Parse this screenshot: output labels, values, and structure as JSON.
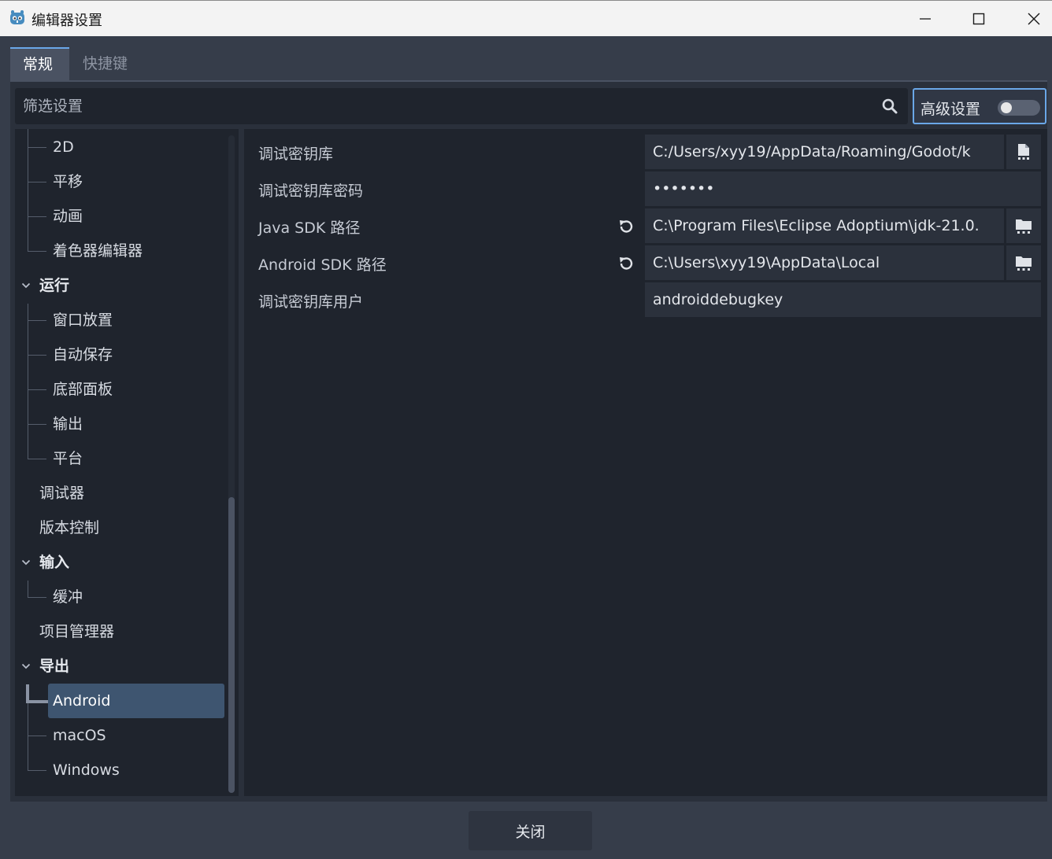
{
  "window": {
    "title": "编辑器设置",
    "controls": [
      "minimize",
      "maximize",
      "close"
    ]
  },
  "tabs": [
    {
      "label": "常规",
      "active": true
    },
    {
      "label": "快捷键",
      "active": false
    }
  ],
  "filter": {
    "placeholder": "筛选设置",
    "icon": "search-icon"
  },
  "advanced": {
    "label": "高级设置",
    "enabled": false
  },
  "tree": {
    "items": [
      {
        "label": "2D",
        "level": 2
      },
      {
        "label": "平移",
        "level": 2
      },
      {
        "label": "动画",
        "level": 2
      },
      {
        "label": "着色器编辑器",
        "level": 2
      },
      {
        "label": "运行",
        "level": 1,
        "section": true,
        "expanded": true
      },
      {
        "label": "窗口放置",
        "level": 2
      },
      {
        "label": "自动保存",
        "level": 2
      },
      {
        "label": "底部面板",
        "level": 2
      },
      {
        "label": "输出",
        "level": 2
      },
      {
        "label": "平台",
        "level": 2
      },
      {
        "label": "调试器",
        "level": 1
      },
      {
        "label": "版本控制",
        "level": 1
      },
      {
        "label": "输入",
        "level": 1,
        "section": true,
        "expanded": true
      },
      {
        "label": "缓冲",
        "level": 2
      },
      {
        "label": "项目管理器",
        "level": 1
      },
      {
        "label": "导出",
        "level": 1,
        "section": true,
        "expanded": true
      },
      {
        "label": "Android",
        "level": 2,
        "selected": true
      },
      {
        "label": "macOS",
        "level": 2
      },
      {
        "label": "Windows",
        "level": 2
      }
    ]
  },
  "properties": [
    {
      "label": "调试密钥库",
      "value": "C:/Users/xyy19/AppData/Roaming/Godot/k",
      "revert": false,
      "folder": true,
      "folder_icon": "file-icon"
    },
    {
      "label": "调试密钥库密码",
      "value": "•••••••",
      "revert": false,
      "folder": false
    },
    {
      "label": "Java SDK 路径",
      "value": "C:\\Program Files\\Eclipse Adoptium\\jdk-21.0.",
      "revert": true,
      "folder": true,
      "folder_icon": "folder-icon"
    },
    {
      "label": "Android SDK 路径",
      "value": "C:\\Users\\xyy19\\AppData\\Local",
      "revert": true,
      "folder": true,
      "folder_icon": "folder-icon"
    },
    {
      "label": "调试密钥库用户",
      "value": "androiddebugkey",
      "revert": false,
      "folder": false
    }
  ],
  "footer": {
    "close_label": "关闭"
  },
  "colors": {
    "accent": "#6aa7e8",
    "selection": "#3e5570",
    "panel": "#1f242d",
    "background": "#363d4a"
  }
}
